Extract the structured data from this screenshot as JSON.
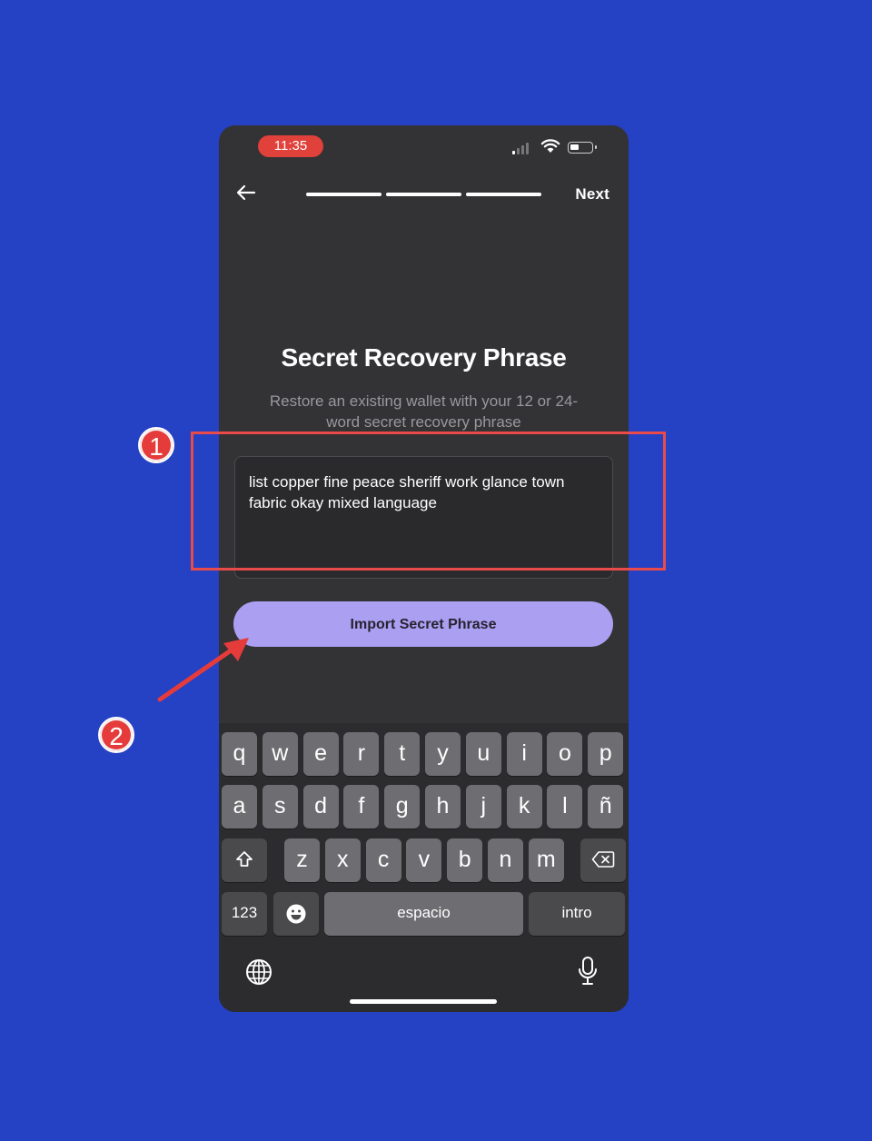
{
  "status": {
    "time": "11:35"
  },
  "nav": {
    "back_icon": "arrow-left-icon",
    "steps": 3,
    "next_label": "Next"
  },
  "main": {
    "title": "Secret Recovery Phrase",
    "subtitle": "Restore an existing wallet with your 12 or 24-word secret recovery phrase",
    "phrase_value": "list copper fine peace sheriff work glance town fabric okay mixed language",
    "import_label": "Import Secret Phrase"
  },
  "keyboard": {
    "row1": [
      "q",
      "w",
      "e",
      "r",
      "t",
      "y",
      "u",
      "i",
      "o",
      "p"
    ],
    "row2": [
      "a",
      "s",
      "d",
      "f",
      "g",
      "h",
      "j",
      "k",
      "l",
      "ñ"
    ],
    "row3": [
      "z",
      "x",
      "c",
      "v",
      "b",
      "n",
      "m"
    ],
    "numbers_label": "123",
    "space_label": "espacio",
    "return_label": "intro"
  },
  "annotations": {
    "badge_1": "1",
    "badge_2": "2",
    "color": "#e63b3b"
  },
  "colors": {
    "background": "#2541c4",
    "phone": "#333235",
    "accent": "#ab9ff2",
    "time_pill": "#e0413a"
  }
}
